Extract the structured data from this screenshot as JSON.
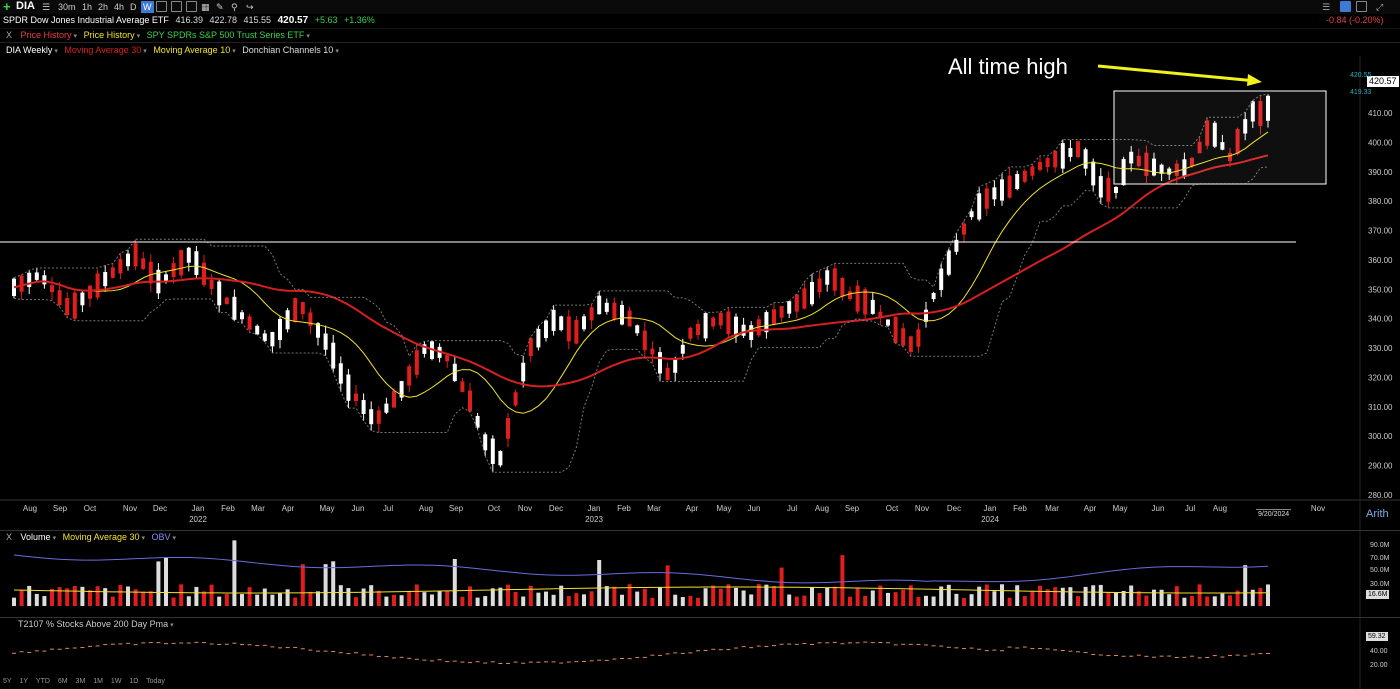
{
  "toolbar": {
    "symbol": "DIA",
    "timeframes": [
      "30m",
      "1h",
      "2h",
      "4h",
      "D",
      "W"
    ],
    "active_timeframe": "W",
    "right_change": "-0.84 (-0.20%)"
  },
  "quote": {
    "name": "SPDR Dow Jones Industrial Average ETF",
    "open": "416.39",
    "high": "422.78",
    "low": "415.55",
    "close": "420.57",
    "change": "+5.63",
    "change_pct": "+1.36%"
  },
  "overlays": {
    "close_x": "X",
    "items": [
      "Price History",
      "Price History",
      "SPY SPDRs S&P 500 Trust Series ETF"
    ],
    "colors": [
      "#e84040",
      "#f2e22b",
      "#37d34c"
    ]
  },
  "studies": {
    "chart_label": "DIA Weekly",
    "items": [
      {
        "label": "Moving Average 30",
        "color": "#d62020"
      },
      {
        "label": "Moving Average 10",
        "color": "#f2e22b"
      },
      {
        "label": "Donchian Channels 10",
        "color": "#dddddd"
      }
    ]
  },
  "annotation": {
    "text": "All time high"
  },
  "price_axis": {
    "ticks": [
      "410.00",
      "400.00",
      "390.00",
      "380.00",
      "370.00",
      "360.00",
      "350.00",
      "340.00",
      "330.00",
      "320.00",
      "310.00",
      "300.00",
      "290.00",
      "280.00"
    ],
    "last_price": "420.57",
    "small_upper": "420.55",
    "small_lower": "419.33"
  },
  "time_axis": {
    "months": [
      "Aug",
      "Sep",
      "Oct",
      "Nov",
      "Dec",
      "Jan",
      "Feb",
      "Mar",
      "Apr",
      "May",
      "Jun",
      "Jul",
      "Aug",
      "Sep",
      "Oct",
      "Nov",
      "Dec",
      "Jan",
      "Feb",
      "Mar",
      "Apr",
      "May",
      "Jun",
      "Jul",
      "Aug",
      "Sep",
      "Oct",
      "Nov",
      "Dec",
      "Jan",
      "Feb",
      "Mar",
      "Apr",
      "May",
      "Jun",
      "Jul",
      "Aug",
      "Nov"
    ],
    "years": [
      "2022",
      "2023",
      "2024"
    ],
    "current_date": "9/20/2024",
    "scale": "Arith"
  },
  "volume_panel": {
    "close_x": "X",
    "label": "Volume",
    "ma_label": "Moving Average 30",
    "obv_label": "OBV",
    "ticks": [
      "90.0M",
      "70.0M",
      "50.0M",
      "30.0M"
    ],
    "last_value": "16.6M"
  },
  "t2107_panel": {
    "label": "T2107 % Stocks Above 200 Day Pma",
    "ticks": [
      "40.00",
      "20.00"
    ],
    "last_value": "59.32"
  },
  "bottom_ranges": [
    "5Y",
    "1Y",
    "YTD",
    "6M",
    "3M",
    "1M",
    "1W",
    "1D",
    "Today"
  ],
  "colors": {
    "up": "#ffffff",
    "down": "#e01e1e",
    "ma30": "#d62020",
    "ma10": "#f2e22b",
    "donchian": "#777777",
    "obv": "#6b6be0",
    "t2107": "#e08a5a"
  }
}
